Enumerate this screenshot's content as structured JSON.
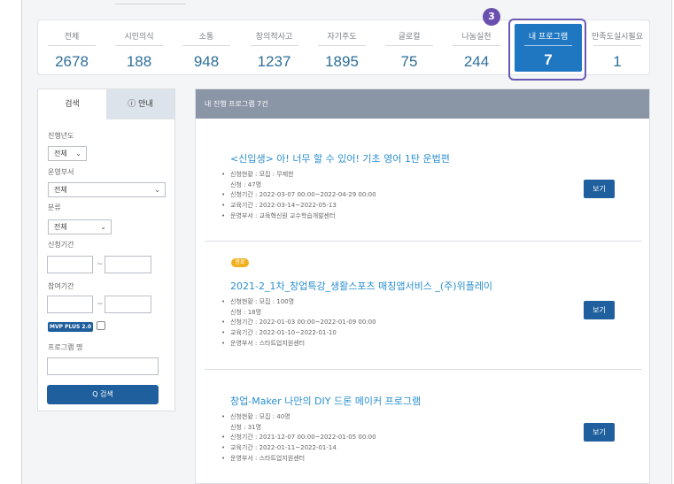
{
  "stats": [
    {
      "label": "전체",
      "value": "2678"
    },
    {
      "label": "시민의식",
      "value": "188"
    },
    {
      "label": "소통",
      "value": "948"
    },
    {
      "label": "창의적사고",
      "value": "1237"
    },
    {
      "label": "자기주도",
      "value": "1895"
    },
    {
      "label": "글로컬",
      "value": "75"
    },
    {
      "label": "나눔실천",
      "value": "244"
    },
    {
      "label": "내 프로그램",
      "value": "7"
    },
    {
      "label": "만족도실시필요",
      "value": "1"
    }
  ],
  "step_marker": "3",
  "tabs": {
    "search": "검색",
    "guide": "ⓘ 안내"
  },
  "filters": {
    "year_label": "진행년도",
    "year_value": "전체",
    "dept_label": "운영부서",
    "dept_value": "전체",
    "category_label": "분류",
    "category_value": "전체",
    "apply_period_label": "신청기간",
    "participate_period_label": "참여기간",
    "tilde": "~",
    "mvp_label": "MVP PLUS 2.0",
    "program_name_label": "프로그램 명",
    "search_button": "Q 검색"
  },
  "results_header": "내 진행 프로그램 7건",
  "programs": [
    {
      "badge": "",
      "title": "<신입생> 아! 너무 할 수 있어! 기초 영어 1탄 운법편",
      "status": "신청현황 : 모집 : 무제한",
      "applied": "신청 : 47명",
      "apply_period": "신청기간 : 2022-03-07 00:00~2022-04-29 00:00",
      "edu_period": "교육기간 : 2022-03-14~2022-05-13",
      "dept": "운영부서 : 교육혁신원 교수학습개발센터",
      "button": "보기"
    },
    {
      "badge": "종료",
      "title": "2021-2_1차_창업특강_생활스포츠 매칭앱서비스 _(주)위플레이",
      "status": "신청현황 : 모집 : 100명",
      "applied": "신청 : 18명",
      "apply_period": "신청기간 : 2022-01-03 00:00~2022-01-09 00:00",
      "edu_period": "교육기간 : 2022-01-10~2022-01-10",
      "dept": "운영부서 : 스타트업지원센터",
      "button": "보기"
    },
    {
      "badge": "",
      "title": "창업-Maker 나만의 DIY 드론 메이커 프로그램",
      "status": "신청현황 : 모집 : 40명",
      "applied": "신청 : 31명",
      "apply_period": "신청기간 : 2021-12-07 00:00~2022-01-05 00:00",
      "edu_period": "교육기간 : 2022-01-11~2022-01-14",
      "dept": "운영부서 : 스타트업지원센터",
      "button": "보기"
    }
  ],
  "bullet": "•",
  "colors": {
    "accent": "#1f77c2",
    "highlight": "#6a58b5",
    "title": "#2a8fd0",
    "button": "#1f5f9d"
  }
}
